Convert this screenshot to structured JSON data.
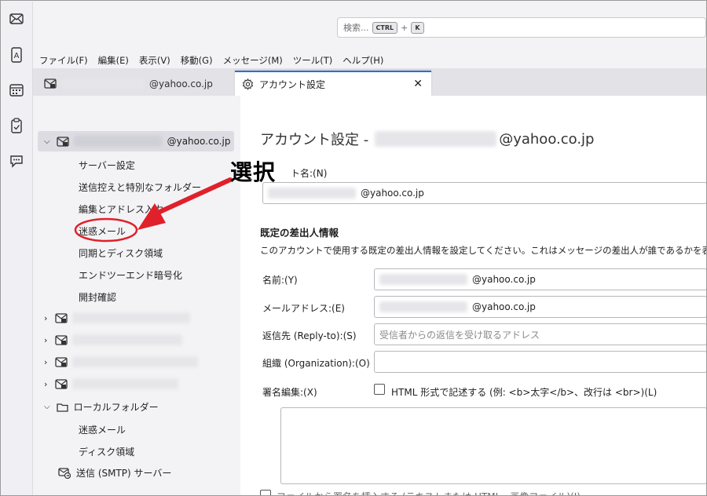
{
  "spaces": [
    "mail-icon",
    "address-book-icon",
    "calendar-icon",
    "tasks-icon",
    "chat-icon"
  ],
  "search": {
    "placeholder": "検索...",
    "key_ctrl": "CTRL",
    "plus": "+",
    "key_k": "K"
  },
  "menubar": [
    "ファイル(F)",
    "編集(E)",
    "表示(V)",
    "移動(G)",
    "メッセージ(M)",
    "ツール(T)",
    "ヘルプ(H)"
  ],
  "tabs": {
    "mail_suffix": "@yahoo.co.jp",
    "settings": "アカウント設定",
    "close": "✕"
  },
  "sidebar": {
    "account_suffix": "@yahoo.co.jp",
    "account_items": [
      "サーバー設定",
      "送信控えと特別なフォルダー",
      "編集とアドレス入力",
      "迷惑メール",
      "同期とディスク領域",
      "エンドツーエンド暗号化",
      "開封確認"
    ],
    "local_folders": "ローカルフォルダー",
    "local_items": [
      "迷惑メール",
      "ディスク領域"
    ],
    "smtp": "送信 (SMTP) サーバー"
  },
  "annotation": {
    "callout": "選択"
  },
  "main": {
    "title_prefix": "アカウント設定 -",
    "title_suffix": "@yahoo.co.jp",
    "account_name_label": "ト名:(N)",
    "account_name_suffix": "@yahoo.co.jp",
    "section_title": "既定の差出人情報",
    "section_desc": "このアカウントで使用する既定の差出人情報を設定してください。これはメッセージの差出人が誰であるかを表すた",
    "name_label": "名前:(Y)",
    "name_suffix": "@yahoo.co.jp",
    "email_label": "メールアドレス:(E)",
    "email_suffix": "@yahoo.co.jp",
    "replyto_label": "返信先 (Reply-to):(S)",
    "replyto_placeholder": "受信者からの返信を受け取るアドレス",
    "org_label": "組織 (Organization):(O)",
    "sig_label": "署名編集:(X)",
    "html_checkbox": "HTML 形式で記述する (例: <b>太字</b>、改行は <br>)(L)",
    "bottom_checkbox": "ファイルから署名を挿入する (テキストまたは HTML、画像ファイル)(I)"
  },
  "colors": {
    "accent": "#2a6fd6",
    "highlight_circle": "#e0202a",
    "arrow": "#e0202a"
  }
}
